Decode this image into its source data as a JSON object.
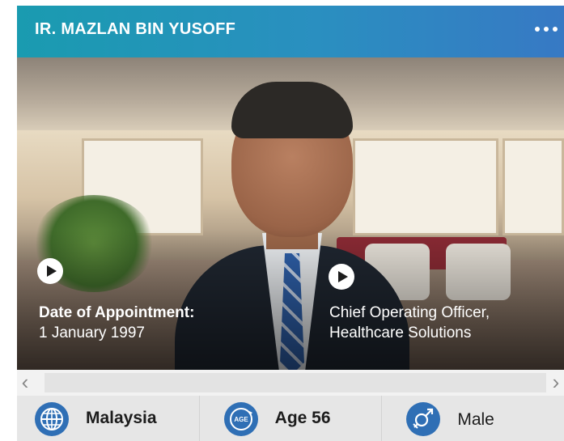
{
  "header": {
    "title": "IR. MAZLAN BIN YUSOFF"
  },
  "profile": {
    "appointment_label": "Date of Appointment:",
    "appointment_date": "1 January 1997",
    "role_line1": "Chief Operating Officer,",
    "role_line2": "Healthcare Solutions"
  },
  "info": {
    "nationality": "Malaysia",
    "age_badge": "AGE",
    "age": "Age 56",
    "gender": "Male"
  },
  "colors": {
    "header_start": "#1a9bb0",
    "header_end": "#3779c4",
    "icon_blue": "#2f6fb5"
  },
  "icons": [
    "more-icon",
    "play-icon",
    "globe-icon",
    "age-icon",
    "gender-icon",
    "chevron-left-icon",
    "chevron-right-icon"
  ]
}
